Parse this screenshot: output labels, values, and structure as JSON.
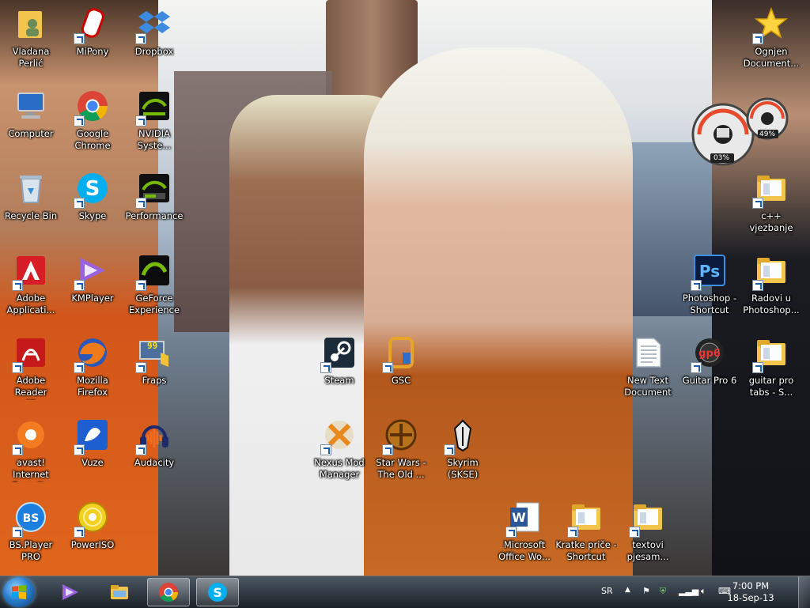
{
  "desktop_icons": [
    {
      "name": "vladana-folder-icon",
      "label": "Vladana Perlić",
      "icon": "user-folder-icon",
      "shortcut": false
    },
    {
      "name": "mipony-icon",
      "label": "MiPony",
      "icon": "mipony-icon",
      "shortcut": true
    },
    {
      "name": "dropbox-icon",
      "label": "Dropbox",
      "icon": "dropbox-icon",
      "shortcut": true
    },
    {
      "name": "ognjen-documents-icon",
      "label": "Ognjen\nDocument...",
      "icon": "star-icon",
      "shortcut": true
    },
    {
      "name": "computer-icon",
      "label": "Computer",
      "icon": "computer-icon",
      "shortcut": false
    },
    {
      "name": "google-chrome-icon",
      "label": "Google\nChrome",
      "icon": "chrome-icon",
      "shortcut": true
    },
    {
      "name": "nvidia-system-icon",
      "label": "NVIDIA\nSyste...",
      "icon": "nvidia-icon",
      "shortcut": true
    },
    {
      "name": "recycle-bin-icon",
      "label": "Recycle Bin",
      "icon": "recycle-bin-icon",
      "shortcut": false
    },
    {
      "name": "skype-icon",
      "label": "Skype",
      "icon": "skype-icon",
      "shortcut": true
    },
    {
      "name": "performance-icon",
      "label": "Performance",
      "icon": "nvidia-performance-icon",
      "shortcut": true
    },
    {
      "name": "cpp-vjezbanje-icon",
      "label": "c++ vjezbanje\n- Shortcut",
      "icon": "folder-icon",
      "shortcut": true
    },
    {
      "name": "adobe-application-icon",
      "label": "Adobe\nApplicati...",
      "icon": "adobe-icon",
      "shortcut": true
    },
    {
      "name": "kmplayer-icon",
      "label": "KMPlayer",
      "icon": "kmplayer-icon",
      "shortcut": true
    },
    {
      "name": "geforce-experience-icon",
      "label": "GeForce\nExperience",
      "icon": "geforce-icon",
      "shortcut": true
    },
    {
      "name": "photoshop-icon",
      "label": "Photoshop -\nShortcut",
      "icon": "photoshop-icon",
      "shortcut": true
    },
    {
      "name": "radovi-photoshop-icon",
      "label": "Radovi u\nPhotoshop...",
      "icon": "folder-icon",
      "shortcut": true
    },
    {
      "name": "adobe-reader-icon",
      "label": "Adobe Reader\nXI",
      "icon": "adobe-reader-icon",
      "shortcut": true
    },
    {
      "name": "mozilla-firefox-icon",
      "label": "Mozilla\nFirefox",
      "icon": "firefox-icon",
      "shortcut": true
    },
    {
      "name": "fraps-icon",
      "label": "Fraps",
      "icon": "fraps-icon",
      "shortcut": true
    },
    {
      "name": "steam-icon",
      "label": "Steam",
      "icon": "steam-icon",
      "shortcut": true
    },
    {
      "name": "gsc-icon",
      "label": "GSC",
      "icon": "gsc-icon",
      "shortcut": true
    },
    {
      "name": "new-text-document-icon",
      "label": "New Text\nDocument",
      "icon": "text-document-icon",
      "shortcut": false
    },
    {
      "name": "guitar-pro-icon",
      "label": "Guitar Pro 6",
      "icon": "guitar-pro-icon",
      "shortcut": true
    },
    {
      "name": "guitar-pro-tabs-icon",
      "label": "guitar pro\ntabs - S...",
      "icon": "folder-icon",
      "shortcut": true
    },
    {
      "name": "avast-icon",
      "label": "avast! Internet\nSecurity",
      "icon": "avast-icon",
      "shortcut": true
    },
    {
      "name": "vuze-icon",
      "label": "Vuze",
      "icon": "vuze-icon",
      "shortcut": true
    },
    {
      "name": "audacity-icon",
      "label": "Audacity",
      "icon": "audacity-icon",
      "shortcut": true
    },
    {
      "name": "nexus-mod-manager-icon",
      "label": "Nexus Mod\nManager",
      "icon": "nexus-icon",
      "shortcut": true
    },
    {
      "name": "star-wars-icon",
      "label": "Star Wars -\nThe Old ...",
      "icon": "star-wars-icon",
      "shortcut": true
    },
    {
      "name": "skyrim-icon",
      "label": "Skyrim (SKSE)",
      "icon": "skyrim-icon",
      "shortcut": true
    },
    {
      "name": "bsplayer-icon",
      "label": "BS.Player PRO",
      "icon": "bsplayer-icon",
      "shortcut": true
    },
    {
      "name": "poweriso-icon",
      "label": "PowerISO",
      "icon": "poweriso-icon",
      "shortcut": true
    },
    {
      "name": "microsoft-word-icon",
      "label": "Microsoft\nOffice Wo...",
      "icon": "word-icon",
      "shortcut": true
    },
    {
      "name": "kratke-price-icon",
      "label": "Kratke priče -\nShortcut",
      "icon": "folder-icon",
      "shortcut": true
    },
    {
      "name": "textovi-pjesama-icon",
      "label": "textovi\npjesam...",
      "icon": "folder-icon",
      "shortcut": true
    }
  ],
  "gadget": {
    "cpu_percent": "03%",
    "memory_percent": "49%"
  },
  "taskbar": {
    "pinned": [
      {
        "name": "taskbar-kmplayer",
        "icon": "kmplayer-icon"
      },
      {
        "name": "taskbar-explorer",
        "icon": "explorer-folder-icon"
      },
      {
        "name": "taskbar-chrome",
        "icon": "chrome-icon"
      },
      {
        "name": "taskbar-skype",
        "icon": "skype-icon"
      }
    ],
    "language": "SR",
    "time": "7:00 PM",
    "date": "18-Sep-13"
  },
  "colors": {
    "taskbar": "#1e252c",
    "label_text": "#ffffff",
    "chrome_red": "#db4437",
    "chrome_green": "#0f9d58",
    "chrome_yellow": "#f4b400",
    "chrome_blue": "#4285f4",
    "nvidia_green": "#76b900",
    "skype_blue": "#00aff0"
  }
}
